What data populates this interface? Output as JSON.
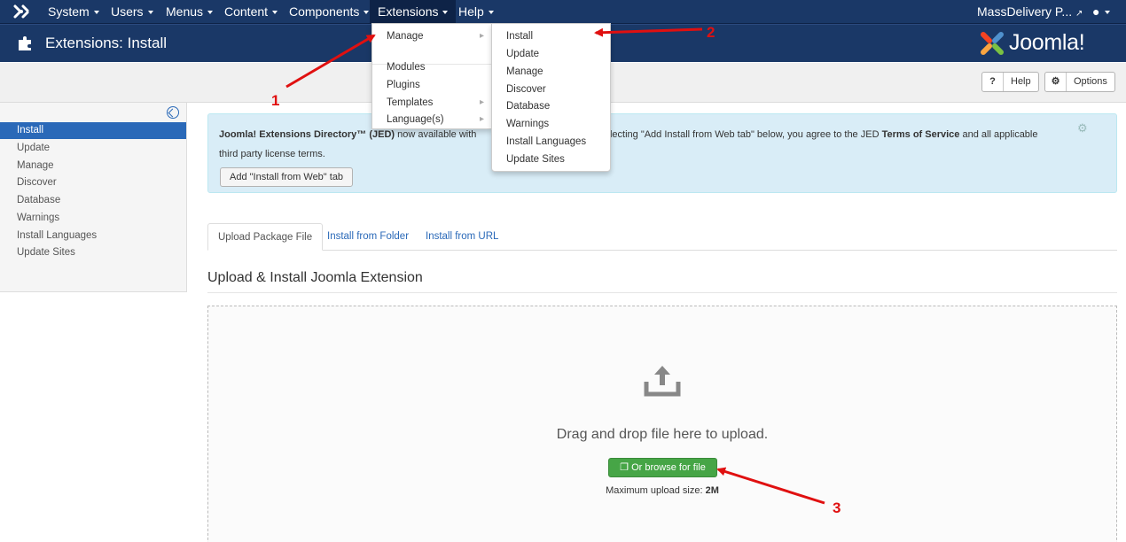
{
  "navbar": {
    "items": [
      {
        "label": "System"
      },
      {
        "label": "Users"
      },
      {
        "label": "Menus"
      },
      {
        "label": "Content"
      },
      {
        "label": "Components"
      },
      {
        "label": "Extensions"
      },
      {
        "label": "Help"
      }
    ],
    "site_link": "MassDelivery P...",
    "user_icon": "user-icon"
  },
  "header": {
    "title": "Extensions: Install",
    "icon": "puzzle-icon",
    "logo_text": "Joomla!"
  },
  "toolbar": {
    "help_label": "Help",
    "options_label": "Options"
  },
  "sidebar": {
    "items": [
      {
        "label": "Install",
        "active": true
      },
      {
        "label": "Update"
      },
      {
        "label": "Manage"
      },
      {
        "label": "Discover"
      },
      {
        "label": "Database"
      },
      {
        "label": "Warnings"
      },
      {
        "label": "Install Languages"
      },
      {
        "label": "Update Sites"
      }
    ]
  },
  "info": {
    "text_bold1": "Joomla! Extensions Directory™ (JED)",
    "text_hidden": " now available with ",
    "text_part2": "By selecting \"Add Install from Web tab\" below, you agree to the JED ",
    "terms": "Terms of Service",
    "text_part3": " and all applicable",
    "line2": "third party license terms.",
    "button": "Add \"Install from Web\" tab"
  },
  "tabs": [
    {
      "label": "Upload Package File",
      "active": true
    },
    {
      "label": "Install from Folder"
    },
    {
      "label": "Install from URL"
    }
  ],
  "section_title": "Upload & Install Joomla Extension",
  "dropzone": {
    "text": "Drag and drop file here to upload.",
    "browse_button": "Or browse for file",
    "max_label": "Maximum upload size:",
    "max_value": "2M"
  },
  "extensions_menu": {
    "items": [
      {
        "label": "Manage",
        "submenu": true
      },
      {
        "label": "Modules"
      },
      {
        "label": "Plugins"
      },
      {
        "label": "Templates",
        "submenu": true
      },
      {
        "label": "Language(s)",
        "submenu": true
      }
    ]
  },
  "manage_submenu": {
    "items": [
      {
        "label": "Install"
      },
      {
        "label": "Update"
      },
      {
        "label": "Manage"
      },
      {
        "label": "Discover"
      },
      {
        "label": "Database"
      },
      {
        "label": "Warnings"
      },
      {
        "label": "Install Languages"
      },
      {
        "label": "Update Sites"
      }
    ]
  },
  "annotations": [
    "1",
    "2",
    "3"
  ],
  "colors": {
    "navbar": "#1a3867",
    "accent": "#2a69b8",
    "info_bg": "#d9edf7",
    "success": "#46a546",
    "annotation": "#e01010"
  }
}
